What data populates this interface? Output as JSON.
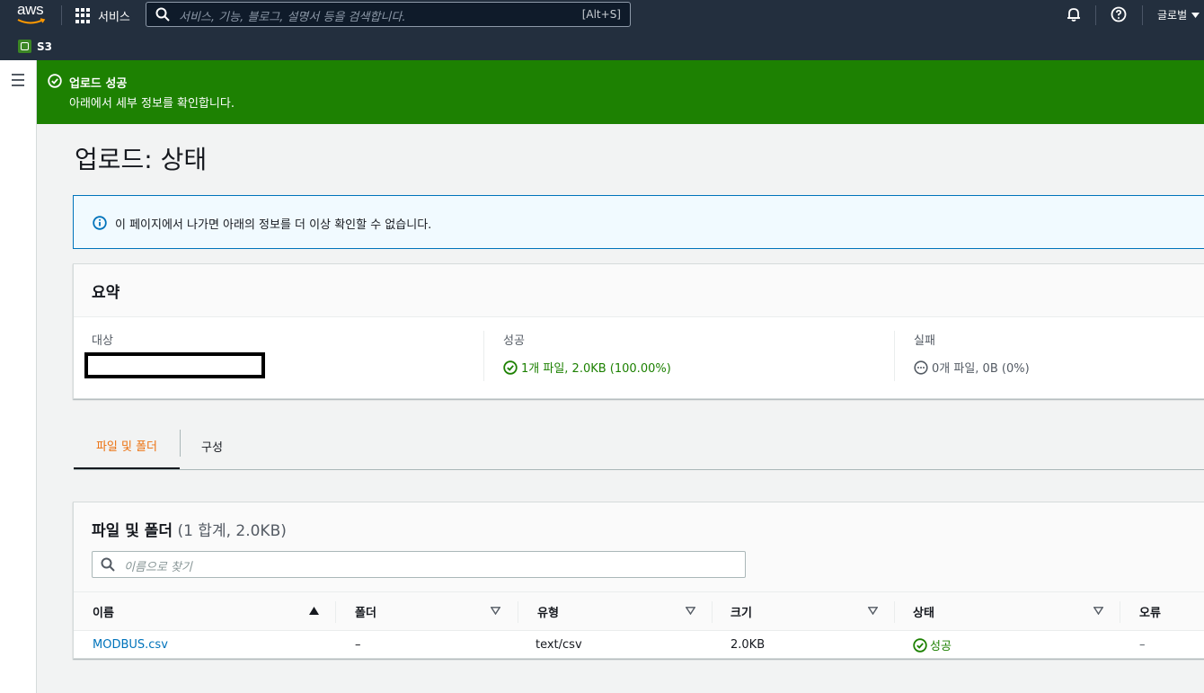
{
  "topnav": {
    "logo_text": "aws",
    "services_label": "서비스",
    "search_placeholder": "서비스, 기능, 블로그, 설명서 등을 검색합니다.",
    "search_shortcut": "[Alt+S]",
    "region_label": "글로벌"
  },
  "servicebar": {
    "service_name": "S3"
  },
  "flash": {
    "title": "업로드 성공",
    "message": "아래에서 세부 정보를 확인합니다."
  },
  "page_title": "업로드: 상태",
  "info_message": "이 페이지에서 나가면 아래의 정보를 더 이상 확인할 수 없습니다.",
  "summary": {
    "title": "요약",
    "destination_label": "대상",
    "destination_value": "",
    "success_label": "성공",
    "success_value": "1개 파일, 2.0KB (100.00%)",
    "failed_label": "실패",
    "failed_value": "0개 파일, 0B (0%)"
  },
  "tabs": [
    {
      "label": "파일 및 폴더",
      "active": true
    },
    {
      "label": "구성",
      "active": false
    }
  ],
  "files": {
    "title": "파일 및 폴더",
    "count": "(1 합계, 2.0KB)",
    "search_placeholder": "이름으로 찾기",
    "columns": [
      "이름",
      "폴더",
      "유형",
      "크기",
      "상태",
      "오류"
    ],
    "rows": [
      {
        "name": "MODBUS.csv",
        "folder": "–",
        "type": "text/csv",
        "size": "2.0KB",
        "status": "성공",
        "error": "–"
      }
    ]
  },
  "colors": {
    "nav_bg": "#232f3e",
    "success_green": "#1d8102",
    "link_blue": "#0073bb",
    "active_tab_orange": "#ec7211",
    "info_bg": "#f1faff"
  }
}
